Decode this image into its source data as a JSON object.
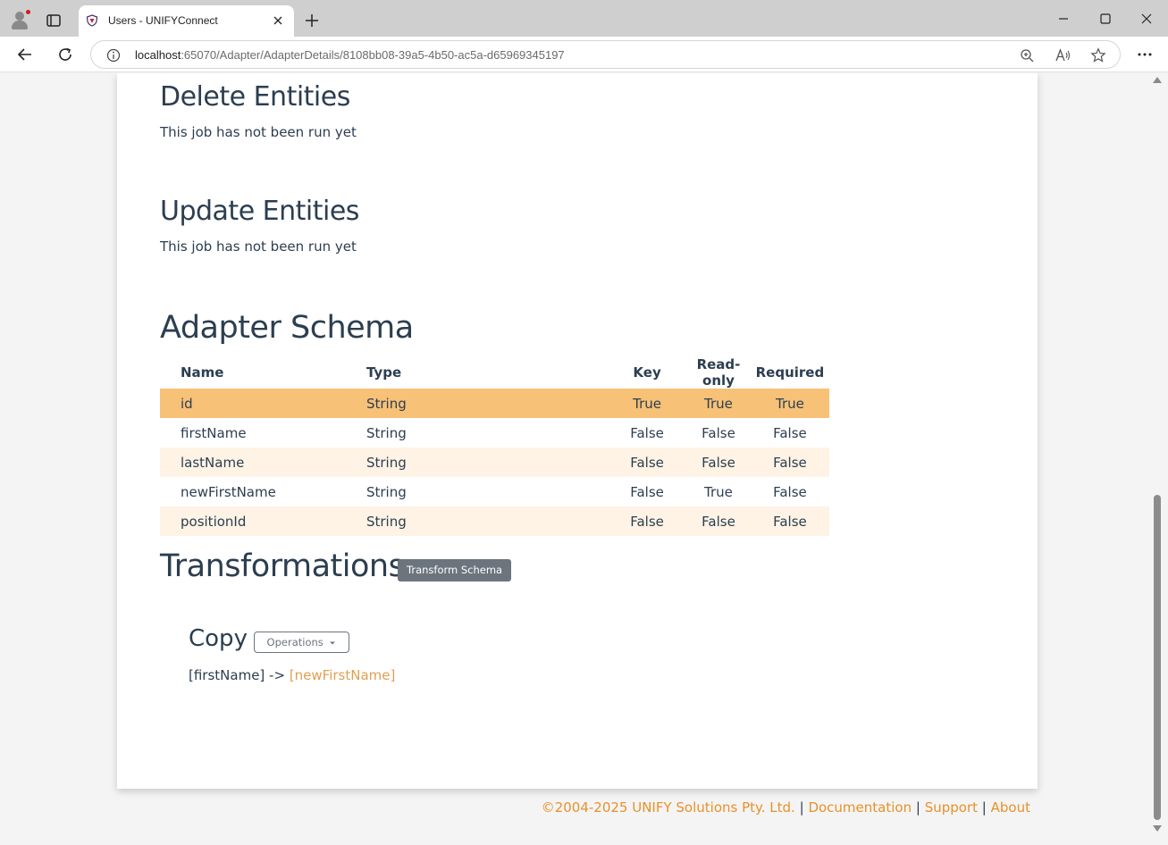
{
  "browser": {
    "tab_title": "Users - UNIFYConnect",
    "url_host": "localhost",
    "url_path": ":65070/Adapter/AdapterDetails/8108bb08-39a5-4b50-ac5a-d65969345197"
  },
  "sections": {
    "delete_title": "Delete Entities",
    "delete_status": "This job has not been run yet",
    "update_title": "Update Entities",
    "update_status": "This job has not been run yet",
    "schema_title": "Adapter Schema",
    "transformations_title": "Transformations"
  },
  "schema_table": {
    "headers": [
      "Name",
      "Type",
      "Key",
      "Read-only",
      "Required"
    ],
    "rows": [
      [
        "id",
        "String",
        "True",
        "True",
        "True"
      ],
      [
        "firstName",
        "String",
        "False",
        "False",
        "False"
      ],
      [
        "lastName",
        "String",
        "False",
        "False",
        "False"
      ],
      [
        "newFirstName",
        "String",
        "False",
        "True",
        "False"
      ],
      [
        "positionId",
        "String",
        "False",
        "False",
        "False"
      ]
    ]
  },
  "transform": {
    "transform_schema_label": "Transform Schema",
    "copy_title": "Copy",
    "operations_label": "Operations",
    "mapping_source": "[firstName] ->",
    "mapping_target": "[newFirstName]"
  },
  "footer": {
    "copyright": "©2004-2025 UNIFY Solutions Pty. Ltd.",
    "sep": "|",
    "documentation": "Documentation",
    "support": "Support",
    "about": "About"
  },
  "colors": {
    "selected_row": "#f7c177",
    "alt_row": "#fef3e5",
    "link": "#e8912a",
    "heading": "#2c3e50"
  },
  "icons": [
    "profile-icon",
    "tab-actions-icon",
    "site-favicon",
    "close-icon",
    "plus-icon",
    "minimize-icon",
    "maximize-icon",
    "window-close-icon",
    "back-arrow-icon",
    "reload-icon",
    "info-icon",
    "zoom-icon",
    "read-aloud-icon",
    "favorite-star-icon",
    "more-dots-icon",
    "caret-down-icon"
  ]
}
